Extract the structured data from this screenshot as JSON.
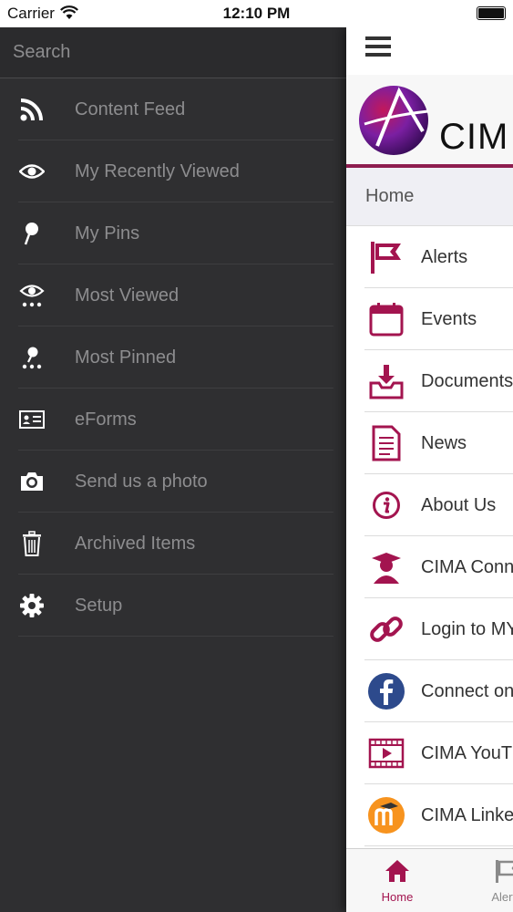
{
  "status_bar": {
    "carrier": "Carrier",
    "time": "12:10 PM"
  },
  "side_menu": {
    "search_placeholder": "Search",
    "items": [
      {
        "label": "Content Feed",
        "icon": "rss-icon"
      },
      {
        "label": "My Recently Viewed",
        "icon": "eye-icon"
      },
      {
        "label": "My Pins",
        "icon": "pin-icon"
      },
      {
        "label": "Most Viewed",
        "icon": "most-viewed-icon"
      },
      {
        "label": "Most Pinned",
        "icon": "most-pinned-icon"
      },
      {
        "label": "eForms",
        "icon": "id-card-icon"
      },
      {
        "label": "Send us a photo",
        "icon": "camera-icon"
      },
      {
        "label": "Archived Items",
        "icon": "trash-icon"
      },
      {
        "label": "Setup",
        "icon": "gear-icon"
      }
    ]
  },
  "content": {
    "logo_text": "CIM",
    "breadcrumb": "Home",
    "items": [
      {
        "label": "Alerts",
        "icon": "flag-icon"
      },
      {
        "label": "Events",
        "icon": "calendar-icon"
      },
      {
        "label": "Documents",
        "icon": "download-tray-icon"
      },
      {
        "label": "News",
        "icon": "document-icon"
      },
      {
        "label": "About Us",
        "icon": "info-icon"
      },
      {
        "label": "CIMA Conn",
        "icon": "graduate-icon"
      },
      {
        "label": "Login to MY",
        "icon": "link-icon"
      },
      {
        "label": "Connect on",
        "icon": "facebook-icon"
      },
      {
        "label": "CIMA YouT",
        "icon": "video-icon"
      },
      {
        "label": "CIMA Linke",
        "icon": "moodle-icon"
      }
    ]
  },
  "tab_bar": {
    "tabs": [
      {
        "label": "Home",
        "active": true
      },
      {
        "label": "Alerts",
        "active": false
      }
    ]
  },
  "colors": {
    "accent": "#a3144f",
    "menu_bg": "#2f2f31",
    "menu_text": "#8d8d8f"
  }
}
